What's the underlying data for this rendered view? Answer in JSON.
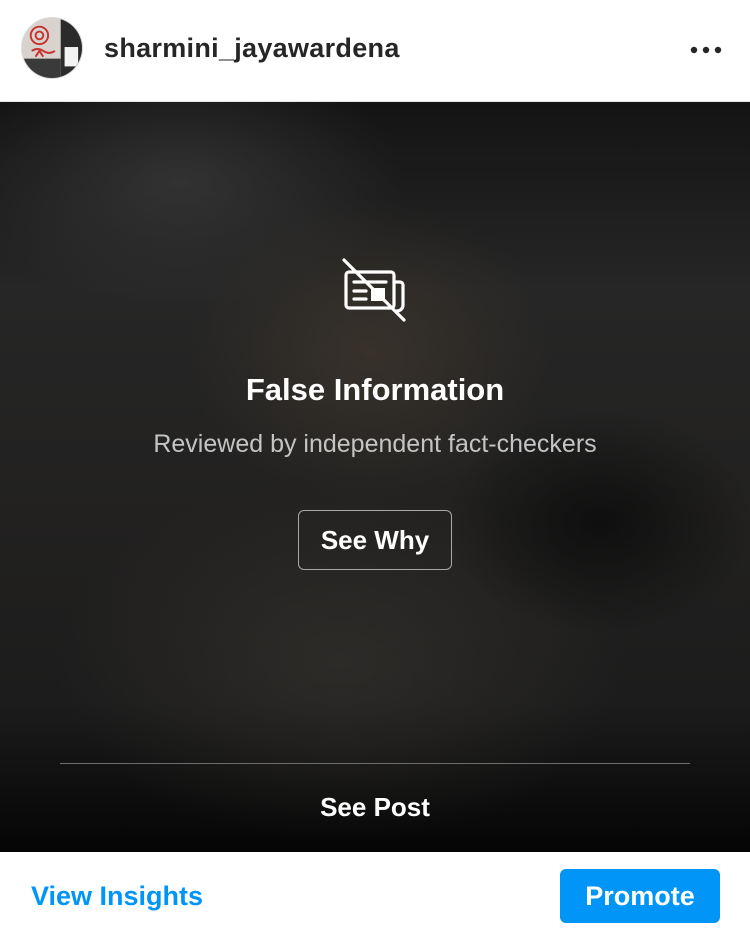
{
  "header": {
    "username": "sharmini_jayawardena",
    "avatar_icon": "profile-photo",
    "more_icon": "more-horizontal-icon"
  },
  "warning": {
    "icon": "false-information-icon",
    "title": "False Information",
    "subtitle": "Reviewed by independent fact-checkers",
    "see_why_label": "See Why",
    "see_post_label": "See Post"
  },
  "footer": {
    "view_insights_label": "View Insights",
    "promote_label": "Promote"
  },
  "colors": {
    "accent": "#0095f6",
    "text_primary": "#262626",
    "overlay_text": "#ffffff",
    "overlay_subtext": "#c4c4c4"
  }
}
